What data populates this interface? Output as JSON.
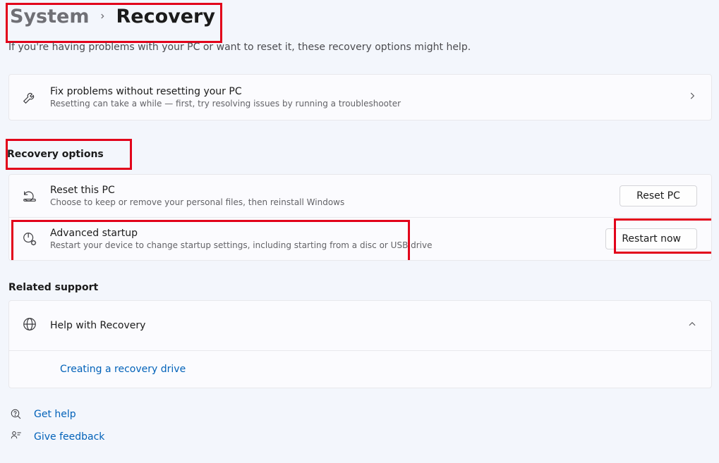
{
  "breadcrumb": {
    "parent": "System",
    "current": "Recovery"
  },
  "intro": "If you're having problems with your PC or want to reset it, these recovery options might help.",
  "fix_card": {
    "title": "Fix problems without resetting your PC",
    "subtitle": "Resetting can take a while — first, try resolving issues by running a troubleshooter"
  },
  "sections": {
    "recovery_options": "Recovery options",
    "related_support": "Related support"
  },
  "reset_row": {
    "title": "Reset this PC",
    "subtitle": "Choose to keep or remove your personal files, then reinstall Windows",
    "button": "Reset PC"
  },
  "advanced_row": {
    "title": "Advanced startup",
    "subtitle": "Restart your device to change startup settings, including starting from a disc or USB drive",
    "button": "Restart now"
  },
  "support": {
    "title": "Help with Recovery",
    "link1": "Creating a recovery drive"
  },
  "footer": {
    "get_help": "Get help",
    "give_feedback": "Give feedback"
  }
}
